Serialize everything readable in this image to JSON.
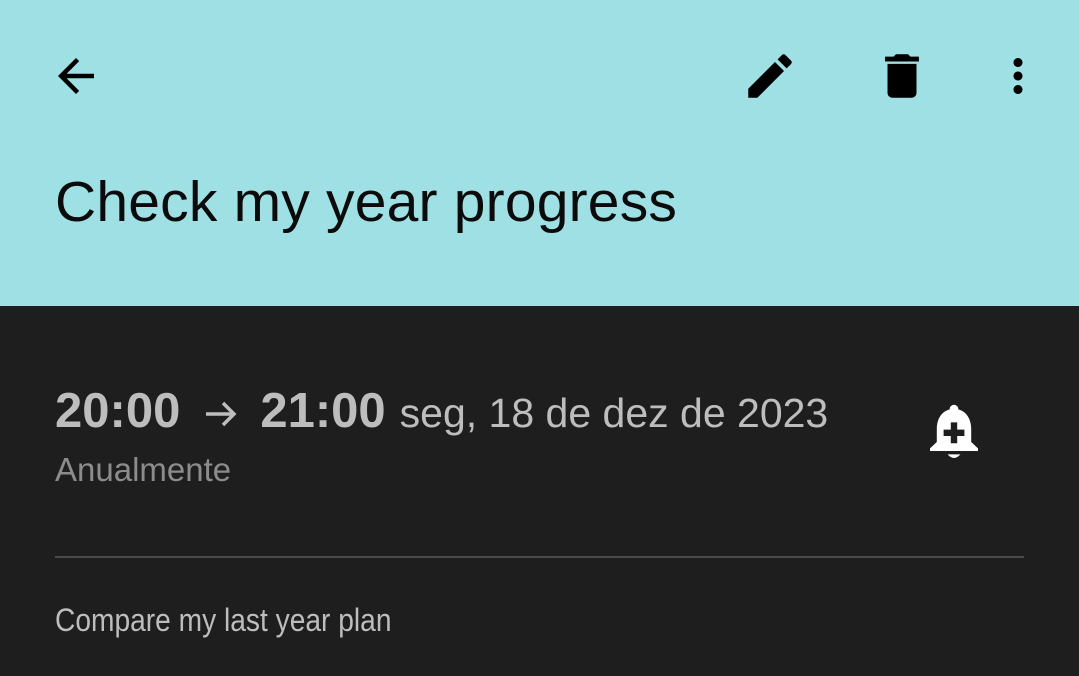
{
  "colors": {
    "header_bg": "#9fe0e5",
    "body_bg": "#1e1e1f",
    "primary_text": "#bdbdbd",
    "secondary_text": "#8c8c8c",
    "title_text": "#0b0b0b"
  },
  "toolbar": {
    "back_icon": "arrow-back-icon",
    "edit_icon": "pencil-icon",
    "delete_icon": "trash-icon",
    "more_icon": "more-vert-icon"
  },
  "event": {
    "title": "Check my year progress",
    "start_time": "20:00",
    "end_time": "21:00",
    "date": "seg, 18 de dez de 2023",
    "recurrence": "Anualmente",
    "reminder_icon": "bell-plus-icon",
    "description": "Compare my last year plan"
  }
}
